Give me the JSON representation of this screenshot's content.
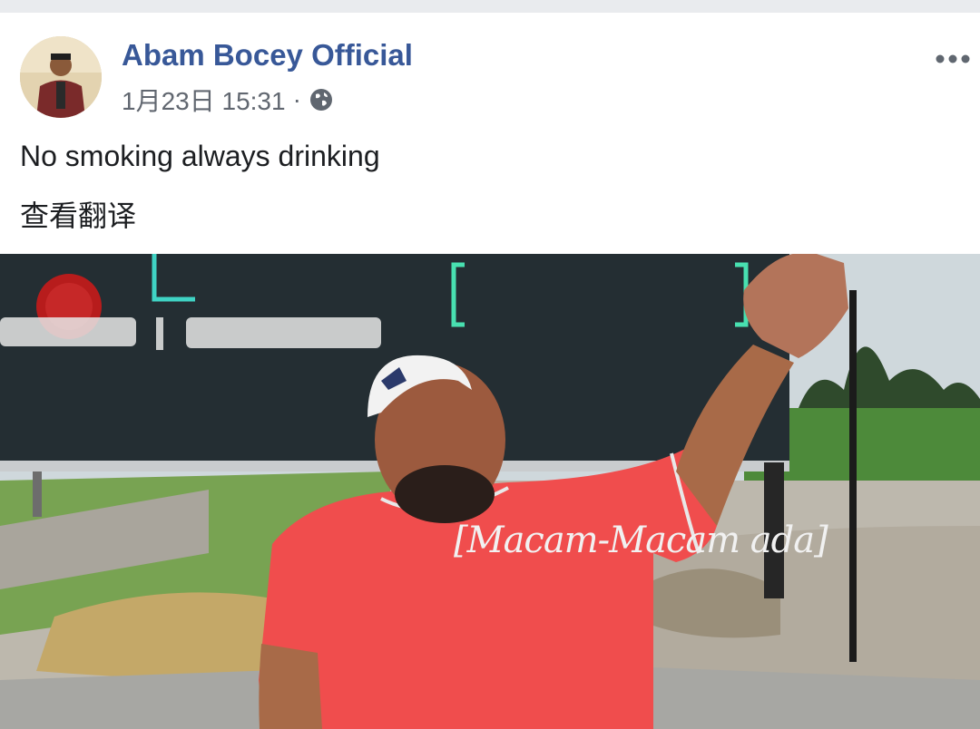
{
  "post": {
    "author": "Abam Bocey Official",
    "timestamp": "1月23日 15:31",
    "separator": "·",
    "privacy_icon": "globe-icon",
    "more_icon": "more-options-icon",
    "text": "No smoking always drinking",
    "translate_label": "查看翻译"
  },
  "media": {
    "sign_text": "[Macam-Macam ada]"
  },
  "colors": {
    "author_link": "#385898",
    "meta_text": "#616770",
    "body_text": "#1c1e21",
    "shirt": "#f04d4d"
  }
}
